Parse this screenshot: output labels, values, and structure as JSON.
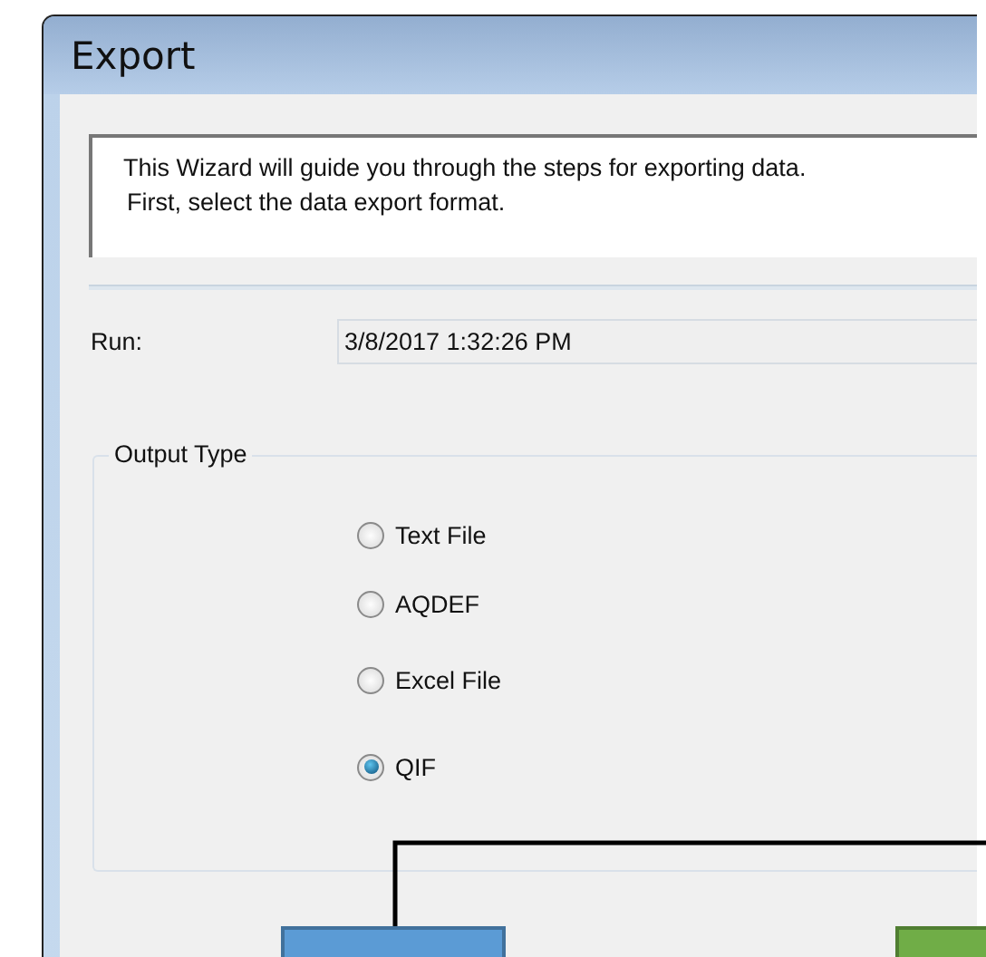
{
  "window": {
    "title": "Export"
  },
  "intro": {
    "lines": [
      "This Wizard will guide you through the steps for exporting data.",
      "First, select the data export format."
    ]
  },
  "run": {
    "label": "Run:",
    "value": "3/8/2017 1:32:26 PM"
  },
  "output_type": {
    "title": "Output Type",
    "options": [
      {
        "label": "Text File",
        "selected": false
      },
      {
        "label": "AQDEF",
        "selected": false
      },
      {
        "label": "Excel File",
        "selected": false
      },
      {
        "label": "QIF",
        "selected": true
      }
    ]
  }
}
